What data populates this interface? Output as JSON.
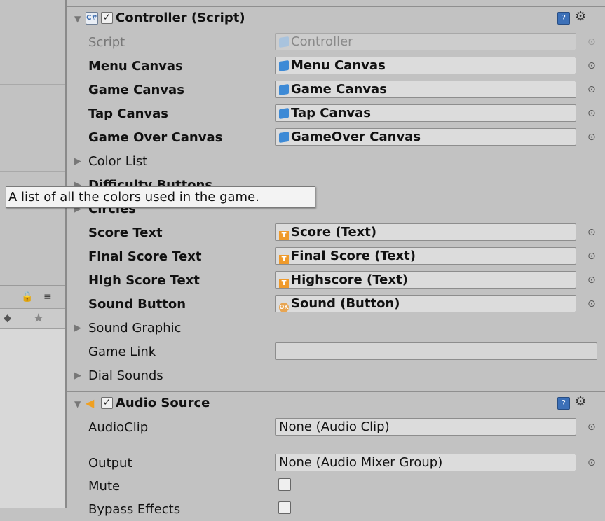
{
  "controller": {
    "title": "Controller (Script)",
    "script_label": "Script",
    "script_value": "Controller",
    "fields": [
      {
        "label": "Menu Canvas",
        "value": "Menu Canvas",
        "icon": "cube-icon"
      },
      {
        "label": "Game Canvas",
        "value": "Game Canvas",
        "icon": "cube-icon"
      },
      {
        "label": "Tap Canvas",
        "value": "Tap Canvas",
        "icon": "cube-icon"
      },
      {
        "label": "Game Over Canvas",
        "value": "GameOver Canvas",
        "icon": "cube-icon"
      }
    ],
    "color_list_label": "Color List",
    "difficulty_buttons_label": "Difficulty Buttons",
    "circles_label": "Circles",
    "text_fields": [
      {
        "label": "Score Text",
        "value": "Score (Text)",
        "icon": "text-icon"
      },
      {
        "label": "Final Score Text",
        "value": "Final Score (Text)",
        "icon": "text-icon"
      },
      {
        "label": "High Score Text",
        "value": "Highscore (Text)",
        "icon": "text-icon"
      },
      {
        "label": "Sound Button",
        "value": "Sound (Button)",
        "icon": "button-icon"
      }
    ],
    "sound_graphic_label": "Sound Graphic",
    "game_link_label": "Game Link",
    "game_link_value": "",
    "dial_sounds_label": "Dial Sounds"
  },
  "audio_source": {
    "title": "Audio Source",
    "audioclip_label": "AudioClip",
    "audioclip_value": "None (Audio Clip)",
    "output_label": "Output",
    "output_value": "None (Audio Mixer Group)",
    "mute_label": "Mute",
    "bypass_label": "Bypass Effects"
  },
  "tooltip": "A list of all the colors used in the game.",
  "icons": {
    "help": "?",
    "gear": "⚙",
    "picker": "⊙",
    "check": "✓",
    "lock": "🔒",
    "menu": "≡",
    "tag": "⬥",
    "star": "★"
  }
}
